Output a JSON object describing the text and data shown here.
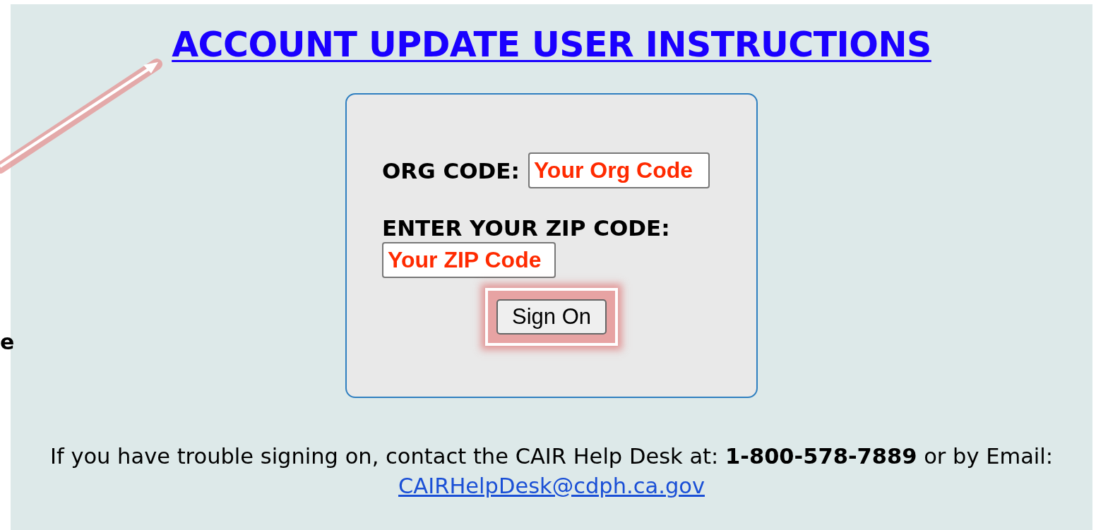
{
  "title": {
    "text": "ACCOUNT UPDATE USER INSTRUCTIONS"
  },
  "edge_fragment": "e",
  "form": {
    "fields": [
      {
        "label": "ORG CODE:",
        "value": "Your Org Code",
        "kind": "inline"
      },
      {
        "label": "ENTER YOUR ZIP CODE:",
        "value": "Your ZIP Code",
        "kind": "stacked"
      }
    ],
    "button": {
      "label": "Sign On",
      "highlighted": true
    }
  },
  "footer": {
    "text": "If you have trouble signing on, contact the CAIR Help Desk at: **1-800-578-7889** or by Email:",
    "email": "CAIRHelpDesk@cdph.ca.gov"
  }
}
